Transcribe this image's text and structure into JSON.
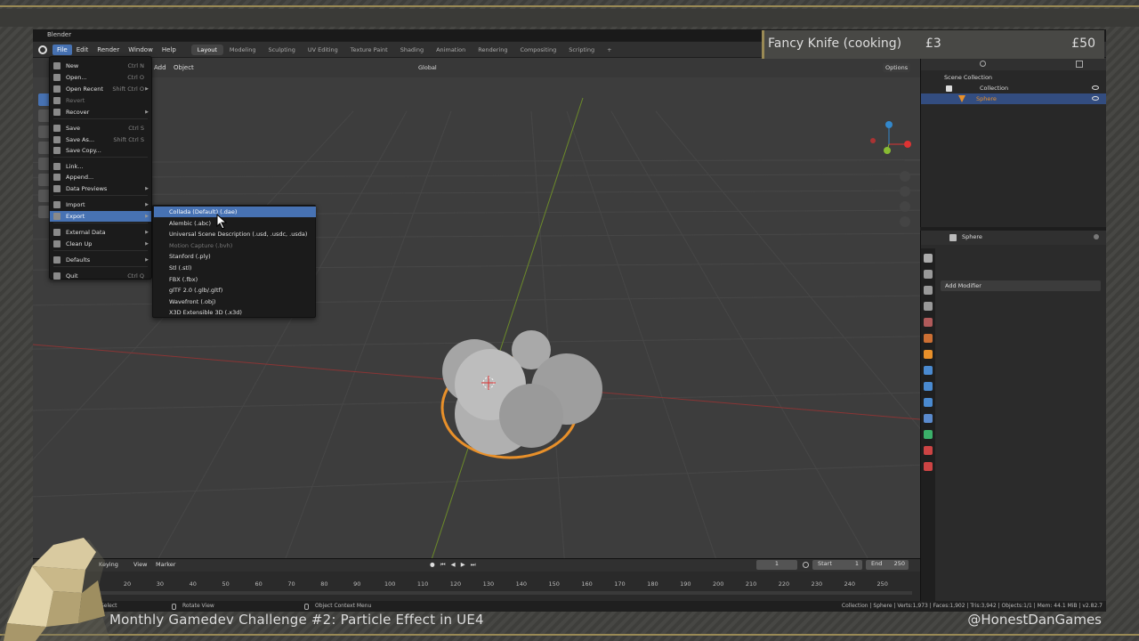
{
  "window": {
    "title": "Blender"
  },
  "menubar": {
    "items": [
      "File",
      "Edit",
      "Render",
      "Window",
      "Help"
    ],
    "workspaces": [
      "Layout",
      "Modeling",
      "Sculpting",
      "UV Editing",
      "Texture Paint",
      "Shading",
      "Animation",
      "Rendering",
      "Compositing",
      "Scripting"
    ],
    "add_tab": "+"
  },
  "viewport": {
    "header_items": [
      "Add",
      "Object"
    ],
    "orientation": "Global",
    "options_label": "Options"
  },
  "file_menu": {
    "items": [
      {
        "label": "New",
        "shortcut": "Ctrl N"
      },
      {
        "label": "Open...",
        "shortcut": "Ctrl O"
      },
      {
        "label": "Open Recent",
        "shortcut": "Shift Ctrl O"
      },
      {
        "label": "Revert",
        "shortcut": ""
      },
      {
        "label": "Recover",
        "shortcut": ""
      },
      {
        "label": "Save",
        "shortcut": "Ctrl S"
      },
      {
        "label": "Save As...",
        "shortcut": "Shift Ctrl S"
      },
      {
        "label": "Save Copy...",
        "shortcut": ""
      },
      {
        "label": "Link...",
        "shortcut": ""
      },
      {
        "label": "Append...",
        "shortcut": ""
      },
      {
        "label": "Data Previews",
        "shortcut": ""
      },
      {
        "label": "Import",
        "shortcut": ""
      },
      {
        "label": "Export",
        "shortcut": ""
      },
      {
        "label": "External Data",
        "shortcut": ""
      },
      {
        "label": "Clean Up",
        "shortcut": ""
      },
      {
        "label": "Defaults",
        "shortcut": ""
      },
      {
        "label": "Quit",
        "shortcut": "Ctrl Q"
      }
    ]
  },
  "export_menu": {
    "items": [
      "Collada (Default) (.dae)",
      "Alembic (.abc)",
      "Universal Scene Description (.usd, .usdc, .usda)",
      "Motion Capture (.bvh)",
      "Stanford (.ply)",
      "Stl (.stl)",
      "FBX (.fbx)",
      "glTF 2.0 (.glb/.gltf)",
      "Wavefront (.obj)",
      "X3D Extensible 3D (.x3d)"
    ]
  },
  "outliner": {
    "scene_collection": "Scene Collection",
    "collection": "Collection",
    "object": "Sphere"
  },
  "properties": {
    "object_name": "Sphere",
    "add_modifier": "Add Modifier"
  },
  "timeline": {
    "menus": [
      "Keying",
      "View",
      "Marker"
    ],
    "current_frame": "1",
    "start_label": "Start",
    "start_value": "1",
    "end_label": "End",
    "end_value": "250",
    "ticks": [
      "20",
      "30",
      "40",
      "50",
      "60",
      "70",
      "80",
      "90",
      "100",
      "110",
      "120",
      "130",
      "140",
      "150",
      "160",
      "170",
      "180",
      "190",
      "200",
      "210",
      "220",
      "230",
      "240",
      "250"
    ]
  },
  "statusbar": {
    "select": "Select",
    "rotate": "Rotate View",
    "context_menu": "Object Context Menu",
    "stats": "Collection | Sphere | Verts:1,973 | Faces:1,902 | Tris:3,942 | Objects:1/1 | Mem: 44.1 MiB | v2.82.7"
  },
  "overlay": {
    "item_name": "Fancy Knife (cooking)",
    "price_left": "£3",
    "price_right": "£50",
    "caption": "Monthly Gamedev Challenge #2: Particle Effect in UE4",
    "handle": "@HonestDanGames"
  },
  "colors": {
    "accent_blue": "#4772b3",
    "gold": "#9a8a55",
    "selection_orange": "#e8902a"
  }
}
